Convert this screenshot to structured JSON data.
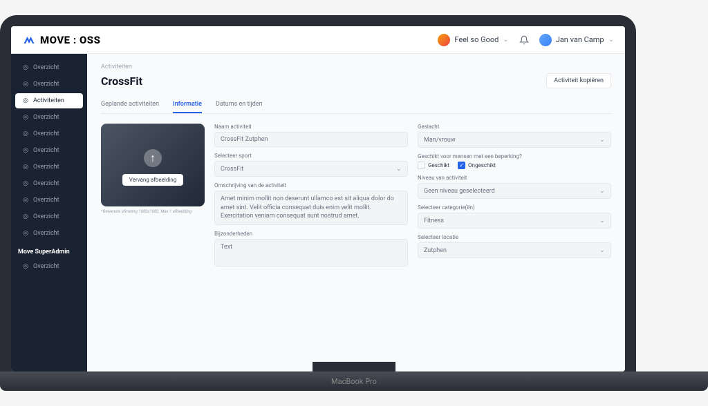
{
  "device_label": "MacBook Pro",
  "logo": {
    "text": "MOVE : OSS"
  },
  "header": {
    "org_name": "Feel so Good",
    "user_name": "Jan van Camp"
  },
  "sidebar": {
    "items": [
      {
        "label": "Overzicht"
      },
      {
        "label": "Overzicht"
      },
      {
        "label": "Activiteiten"
      },
      {
        "label": "Overzicht"
      },
      {
        "label": "Overzicht"
      },
      {
        "label": "Overzicht"
      },
      {
        "label": "Overzicht"
      },
      {
        "label": "Overzicht"
      },
      {
        "label": "Overzicht"
      },
      {
        "label": "Overzicht"
      },
      {
        "label": "Overzicht"
      }
    ],
    "section_title": "Move SuperAdmin",
    "section_items": [
      {
        "label": "Overzicht"
      }
    ]
  },
  "page": {
    "breadcrumb": "Activiteiten",
    "title": "CrossFit",
    "copy_button": "Activiteit kopiëren"
  },
  "tabs": {
    "planned": "Geplande activiteiten",
    "info": "Informatie",
    "dates": "Datums en tijden"
  },
  "form": {
    "image_upload_label": "Vervang afbeelding",
    "image_hint": "*Gewenste afmeting 1080x1080. Max 1 afbeelding",
    "name_label": "Naam activiteit",
    "name_value": "CrossFit Zutphen",
    "sport_label": "Selecteer sport",
    "sport_value": "CrossFit",
    "description_label": "Omschrijving van de activiteit",
    "description_value": "Amet minim mollit non deserunt ullamco est sit aliqua dolor do amet sint. Velit officia consequat duis enim velit mollit. Exercitation veniam consequat sunt nostrud amet.",
    "details_label": "Bijzonderheden",
    "details_placeholder": "Text",
    "gender_label": "Geslacht",
    "gender_value": "Man/vrouw",
    "disability_label": "Geschikt voor mensen met een beperking?",
    "disability_yes": "Geschikt",
    "disability_no": "Ongeschikt",
    "level_label": "Niveau van activiteit",
    "level_value": "Geen niveau geselecteerd",
    "category_label": "Selecteer categorie(ën)",
    "category_value": "Fitness",
    "location_label": "Selecteer locatie",
    "location_value": "Zutphen"
  }
}
